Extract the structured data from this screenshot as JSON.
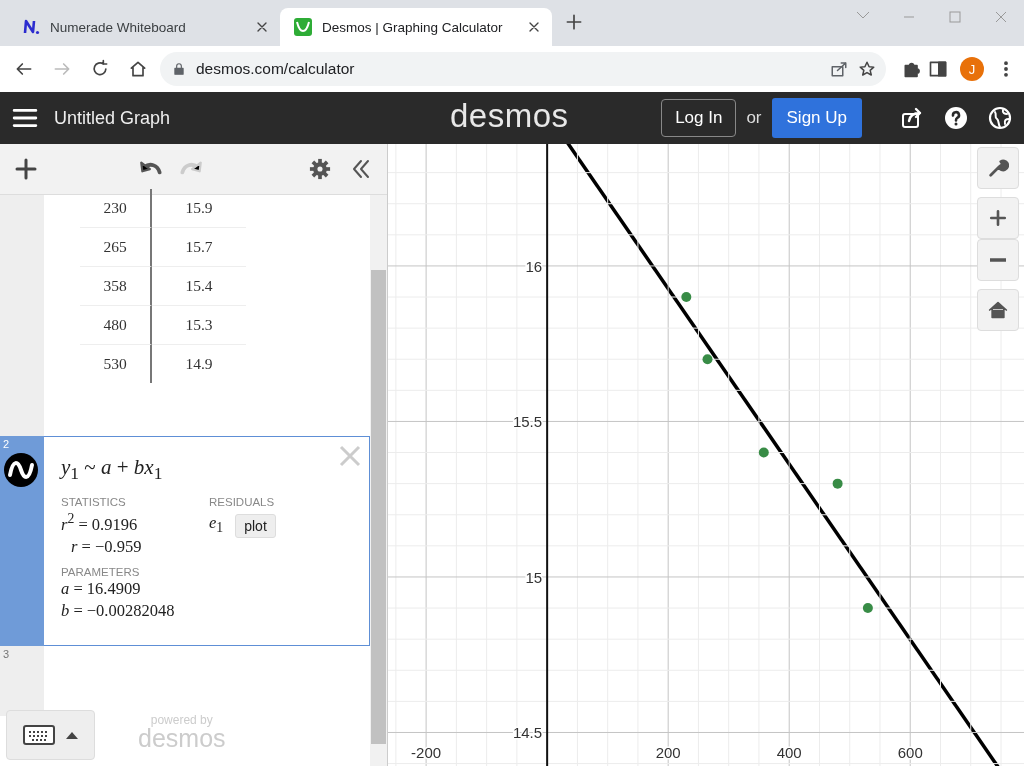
{
  "browser": {
    "tabs": [
      {
        "title": "Numerade Whiteboard",
        "selected": false
      },
      {
        "title": "Desmos | Graphing Calculator",
        "selected": true
      }
    ],
    "url": "desmos.com/calculator",
    "profile": "J"
  },
  "header": {
    "title": "Untitled Graph",
    "logo": "desmos",
    "login": "Log In",
    "or": "or",
    "signup": "Sign Up"
  },
  "toolbar": {
    "undo_disabled": false,
    "redo_disabled": true
  },
  "expressions": [
    {
      "kind": "table",
      "selected": false,
      "rows": [
        [
          "230",
          "15.9"
        ],
        [
          "265",
          "15.7"
        ],
        [
          "358",
          "15.4"
        ],
        [
          "480",
          "15.3"
        ],
        [
          "530",
          "14.9"
        ]
      ]
    },
    {
      "kind": "regression",
      "number": "2",
      "selected": true,
      "formula": "*y*$_{1}$ ~ *a* + *bx*$_{1}$",
      "statistics": {
        "heading": "STATISTICS",
        "lines": [
          "*r*$^{2}$ = 0.9196",
          "*r* = −0.959"
        ]
      },
      "residuals": {
        "heading": "RESIDUALS",
        "variable": "*e*$_{1}$",
        "button": "plot"
      },
      "parameters": {
        "heading": "PARAMETERS",
        "lines": [
          "*a* = 16.4909",
          "*b* = −0.00282048"
        ]
      }
    },
    {
      "kind": "empty",
      "number": "3",
      "selected": false
    }
  ],
  "footer": {
    "powered_by": "powered by",
    "logo": "desmos"
  },
  "graph": {
    "chart_data": {
      "type": "scatter",
      "x": [
        230,
        265,
        358,
        480,
        530
      ],
      "series": [
        {
          "color": "#388c46",
          "values": [
            15.9,
            15.7,
            15.4,
            15.3,
            14.9
          ]
        }
      ],
      "xlim": [
        -263,
        788
      ],
      "ylim": [
        14.389,
        16.392
      ],
      "xticks": [
        -200,
        200,
        400,
        600
      ],
      "yticks": [
        14.5,
        15,
        15.5,
        16
      ],
      "grid": true
    }
  }
}
